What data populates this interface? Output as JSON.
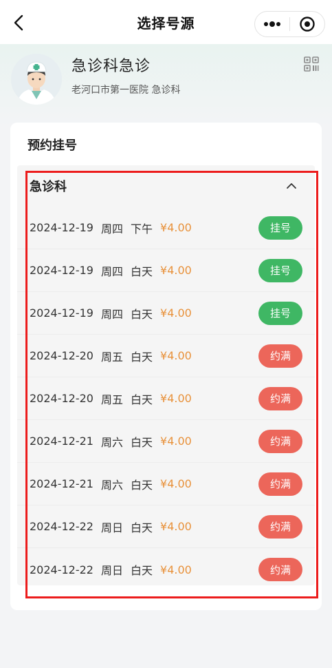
{
  "nav": {
    "title": "选择号源",
    "icons": {
      "back": "chevron-left-icon",
      "more": "more-dots-icon",
      "close": "target-icon"
    }
  },
  "header": {
    "department_name": "急诊科急诊",
    "hospital_info": "老河口市第一医院  急诊科",
    "icons": {
      "avatar": "doctor-avatar",
      "qr": "qr-code-icon"
    }
  },
  "card": {
    "title": "预约挂号",
    "group": {
      "title": "急诊科",
      "expanded": true,
      "toggle_icon": "chevron-up-icon",
      "rows": [
        {
          "date": "2024-12-19",
          "weekday": "周四",
          "period": "下午",
          "price": "¥4.00",
          "action": "挂号",
          "status": "available"
        },
        {
          "date": "2024-12-19",
          "weekday": "周四",
          "period": "白天",
          "price": "¥4.00",
          "action": "挂号",
          "status": "available"
        },
        {
          "date": "2024-12-19",
          "weekday": "周四",
          "period": "白天",
          "price": "¥4.00",
          "action": "挂号",
          "status": "available"
        },
        {
          "date": "2024-12-20",
          "weekday": "周五",
          "period": "白天",
          "price": "¥4.00",
          "action": "约满",
          "status": "full"
        },
        {
          "date": "2024-12-20",
          "weekday": "周五",
          "period": "白天",
          "price": "¥4.00",
          "action": "约满",
          "status": "full"
        },
        {
          "date": "2024-12-21",
          "weekday": "周六",
          "period": "白天",
          "price": "¥4.00",
          "action": "约满",
          "status": "full"
        },
        {
          "date": "2024-12-21",
          "weekday": "周六",
          "period": "白天",
          "price": "¥4.00",
          "action": "约满",
          "status": "full"
        },
        {
          "date": "2024-12-22",
          "weekday": "周日",
          "period": "白天",
          "price": "¥4.00",
          "action": "约满",
          "status": "full"
        },
        {
          "date": "2024-12-22",
          "weekday": "周日",
          "period": "白天",
          "price": "¥4.00",
          "action": "约满",
          "status": "full"
        }
      ]
    }
  },
  "colors": {
    "available": "#3fb764",
    "full": "#ec665a",
    "price": "#e8913a",
    "highlight": "#ec1c1c"
  }
}
